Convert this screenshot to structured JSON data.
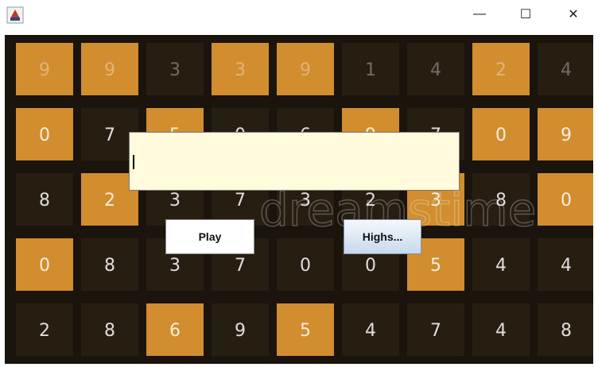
{
  "window": {
    "title": "",
    "controls": {
      "minimize": "—",
      "maximize": "☐",
      "close": "✕"
    }
  },
  "form": {
    "name_input_value": "",
    "play_label": "Play",
    "highscores_label": "Highs..."
  },
  "background": {
    "watermark": "dreamstime",
    "tile_rows": [
      [
        "9",
        "9",
        "3",
        "3",
        "9",
        "1",
        "4",
        "2",
        "4"
      ],
      [
        "0",
        "7",
        "5",
        "0",
        "6",
        "9",
        "7",
        "0",
        "9"
      ],
      [
        "8",
        "2",
        "3",
        "7",
        "3",
        "2",
        "3",
        "8",
        "0"
      ],
      [
        "0",
        "8",
        "3",
        "7",
        "0",
        "0",
        "5",
        "4",
        "4"
      ],
      [
        "2",
        "8",
        "6",
        "9",
        "5",
        "4",
        "7",
        "4",
        "8"
      ]
    ]
  },
  "colors": {
    "tile_orange": "#e69a32",
    "tile_dark": "#2a2014",
    "field_bg": "#fffbdc"
  }
}
